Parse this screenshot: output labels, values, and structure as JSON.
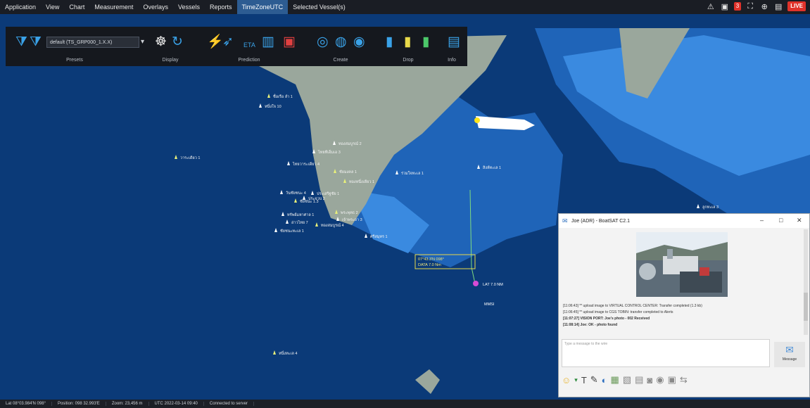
{
  "menu": {
    "items": [
      "Application",
      "View",
      "Chart",
      "Measurement",
      "Overlays",
      "Vessels",
      "Reports",
      "TimeZoneUTC",
      "Selected Vessel(s)"
    ],
    "active_index": 7,
    "badge_count": "3",
    "alert_label": "LIVE"
  },
  "ribbon": {
    "preset_value": "default (TS_GRP000_1.X.X)",
    "groups": [
      "Presets",
      "Display",
      "Prediction",
      "Create",
      "Drop",
      "Info"
    ]
  },
  "map": {
    "colors": {
      "deep": "#0b3a78",
      "shallow": "#1f64b8",
      "coast": "#3a8ae0",
      "land": "#9aa79c"
    },
    "labels": [
      "ชื่อเรือ ลำ 1",
      "หนึ่งใจ 10",
      "ไทยทีเอ็มเอ 3",
      "วาระเดียว 1",
      "ไทยวาระเดียว 4",
      "ทองสมบูรณ์ 2",
      "ทองหนึ่งเดียว 1",
      "วันชัยชนะ 4",
      "ประเสริฐชัย 1",
      "ชัยชนะ 1.3",
      "ทรัพย์มหาศาล 1",
      "เจ้าพระยา 3",
      "ทองสมบูรณ์ 4",
      "ศรีสมุทร 1",
      "ชัยชนะทะเล 1",
      "ชัยมงคล 1",
      "สิงห์ทะเล 1",
      "ลูกทะเล 3",
      "หนึ่งทะเล 4",
      "ร่วมใจทะเล 1",
      "อ่าวไทย 7",
      "พระพุทธ 2",
      "ประจวบ 2"
    ],
    "target_box_line1": "07°43.3′N 098°",
    "target_box_line2": "DATA 7.0 Nm",
    "cursor_label": "LAT 7.0 NM",
    "cursor_sublabel": "MMSI"
  },
  "statusbar": {
    "cells": [
      "Lat 08°03.984′N 098°",
      "Position: 098 32.993′E",
      "Zoom: 23,456 m",
      "UTC 2022-03-14 09:40",
      "Connected to server"
    ]
  },
  "chat": {
    "title": "Joe (ADR) - BoatSAT C2.1",
    "messages": [
      "[11:06:43] ** upload image to VIRTUAL CONTROL CENTER: Transfer completed (1.3 kb)",
      "[11:06:45] ** upload image to CGS TOBIN: transfer completed to Alerts",
      "[11:07:27] VISION PORT: Joe's photo - 002 Received",
      "[11:08:14] Joe: OK - photo found"
    ],
    "input_placeholder": "Type a message to the wire",
    "send_label": "Message"
  }
}
